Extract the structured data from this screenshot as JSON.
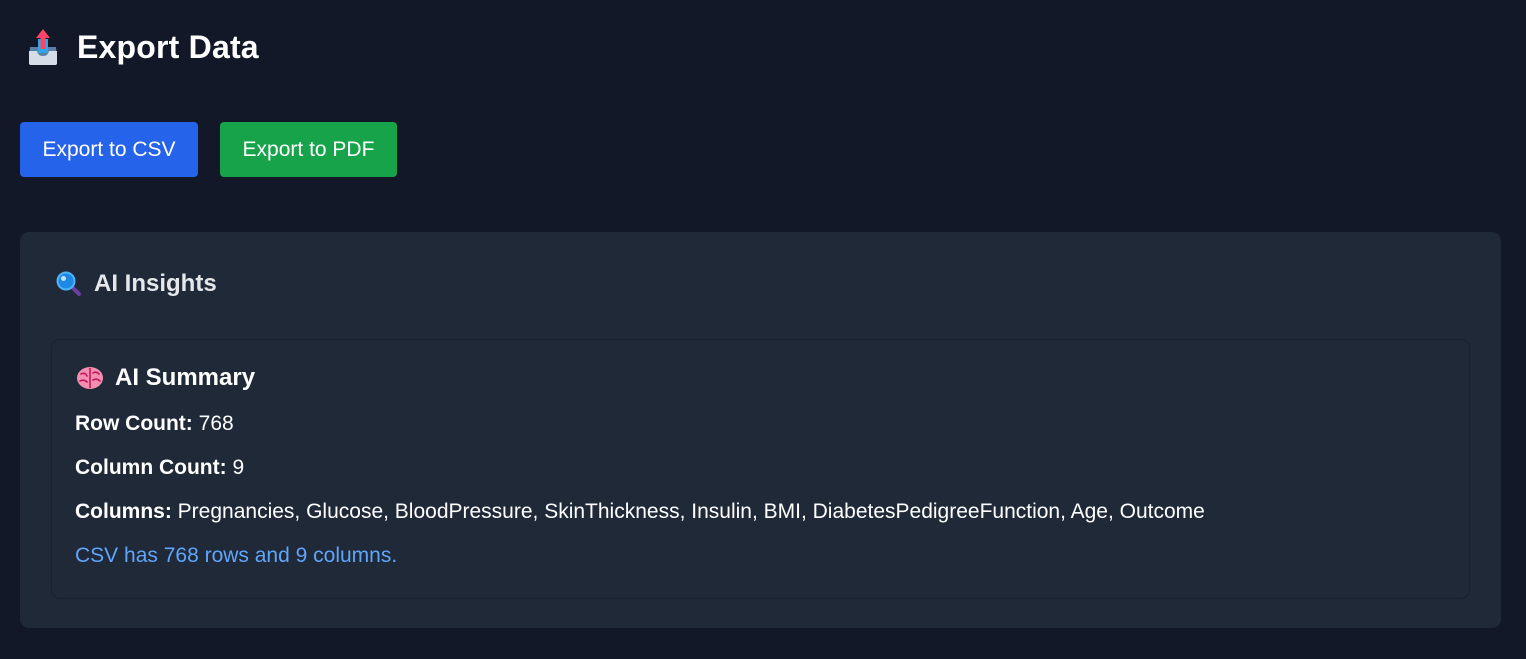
{
  "header": {
    "icon": "outbox-tray-icon",
    "title": "Export Data"
  },
  "actions": {
    "csv_label": "Export to CSV",
    "pdf_label": "Export to PDF",
    "csv_color": "#2563eb",
    "pdf_color": "#16a34a"
  },
  "insights": {
    "icon": "magnifying-glass-icon",
    "title": "AI Insights",
    "summary": {
      "icon": "brain-icon",
      "title": "AI Summary",
      "row_count_label": "Row Count:",
      "row_count_value": "768",
      "column_count_label": "Column Count:",
      "column_count_value": "9",
      "columns_label": "Columns:",
      "columns_value": "Pregnancies, Glucose, BloodPressure, SkinThickness, Insulin, BMI, DiabetesPedigreeFunction, Age, Outcome",
      "note": "CSV has 768 rows and 9 columns.",
      "note_color": "#60a5fa"
    }
  },
  "colors": {
    "background": "#121827",
    "card": "#1f2937"
  }
}
